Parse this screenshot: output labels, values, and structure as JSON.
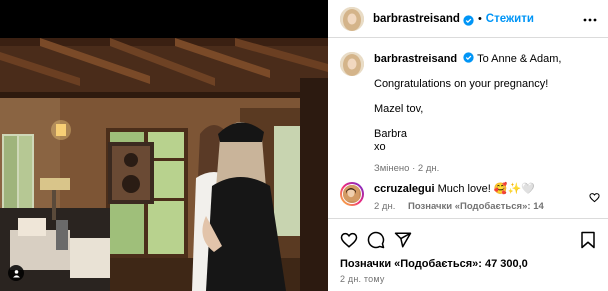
{
  "post": {
    "author": "barbrastreisand",
    "follow_label": "Стежити",
    "caption": {
      "lines": [
        "To Anne & Adam,",
        "Congratulations on your pregnancy!",
        "Mazel tov,",
        "Barbra",
        "xo"
      ],
      "edited": "Змінено",
      "time": "2 дн."
    },
    "comment": {
      "author": "ccruzalegui",
      "text": "Much love! 🥰✨🤍",
      "time": "2 дн.",
      "likes": "Позначки «Подобається»: 14"
    },
    "likes_total": "Позначки «Подобається»: 47 300,0",
    "posted": "2 дн. тому"
  },
  "icons": {
    "verified": "verified-badge-icon",
    "more": "more-options-icon",
    "like": "heart-icon",
    "comment": "comment-icon",
    "share": "share-icon",
    "save": "bookmark-icon",
    "user_tag": "user-tag-icon"
  },
  "colors": {
    "accent": "#0095f6",
    "secondary_text": "#737373",
    "divider": "#dbdbdb"
  }
}
